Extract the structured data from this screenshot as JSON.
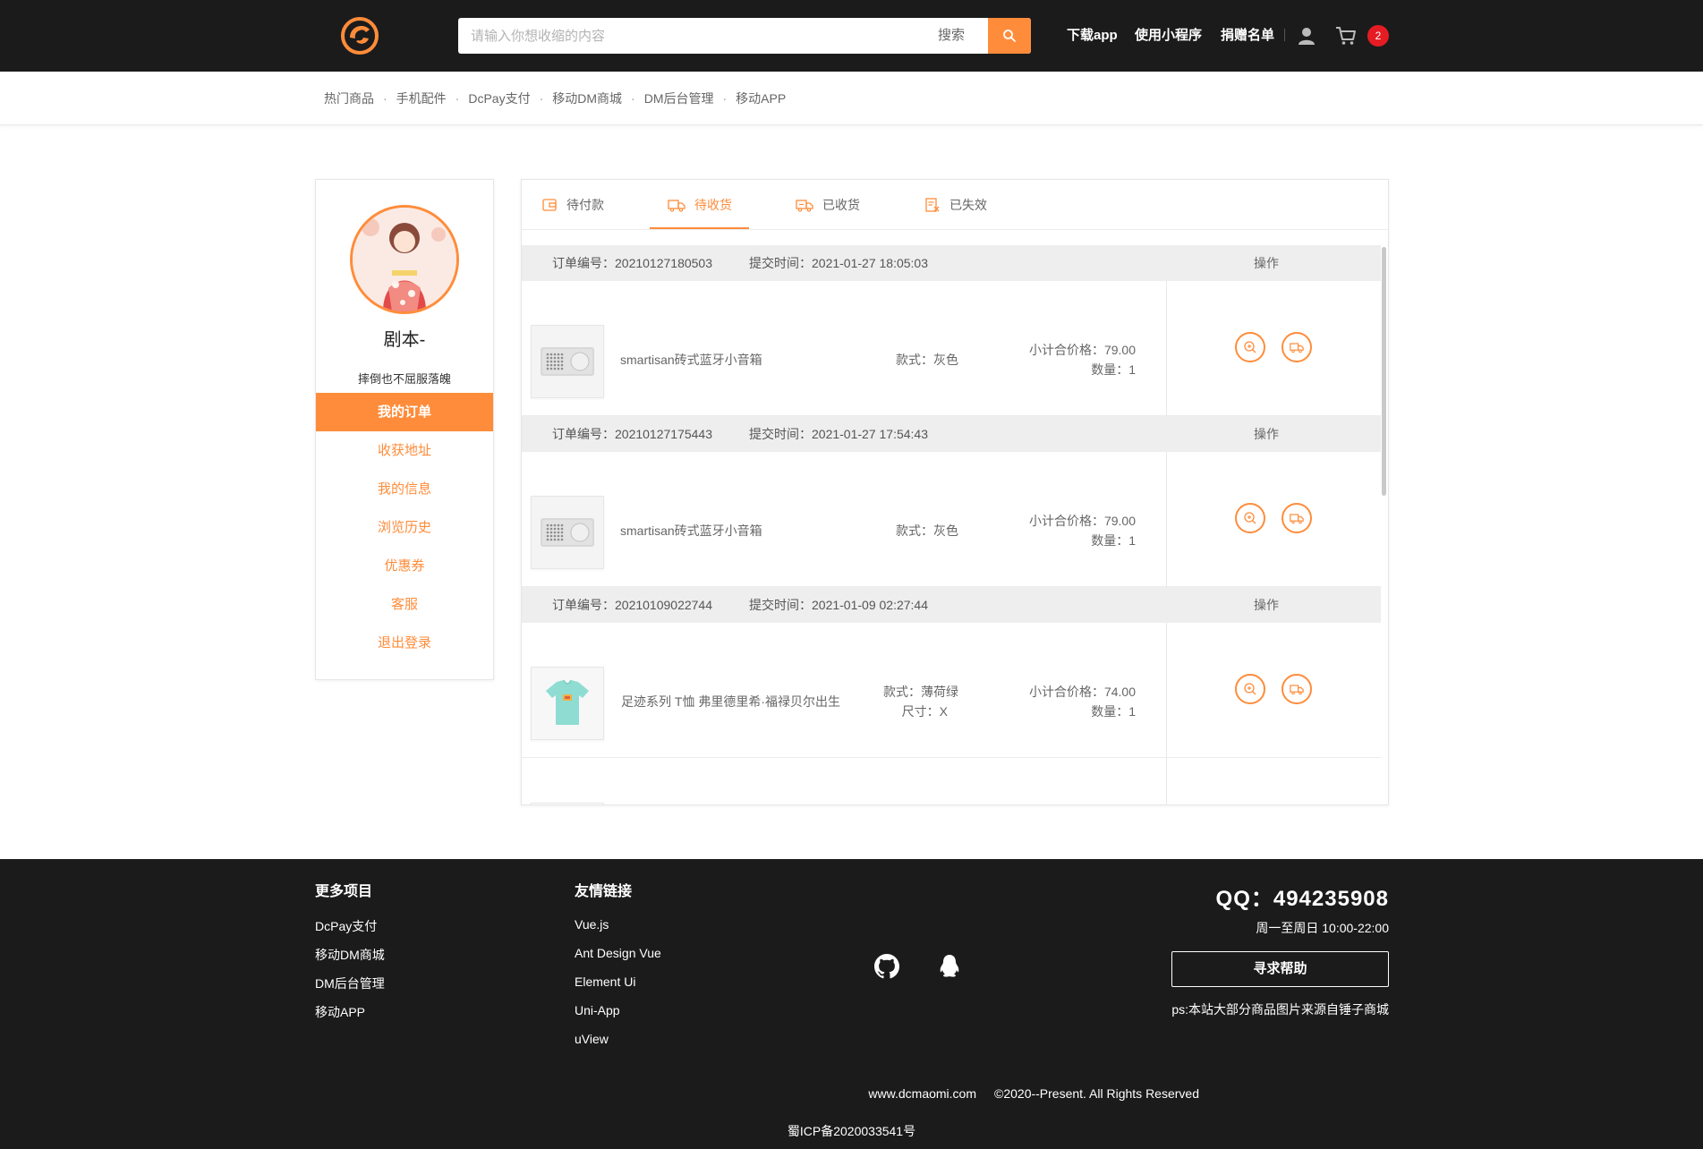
{
  "header": {
    "search_placeholder": "请输入你想收缩的内容",
    "search_label": "搜索",
    "nav_links": [
      "下载app",
      "使用小程序",
      "捐赠名单"
    ],
    "cart_count": "2",
    "accent_color": "#ff8c3a"
  },
  "subnav": {
    "items": [
      "热门商品",
      "手机配件",
      "DcPay支付",
      "移动DM商城",
      "DM后台管理",
      "移动APP"
    ],
    "separator": "·"
  },
  "sidebar": {
    "username": "剧本-",
    "signature": "摔倒也不屈服落魄",
    "menu": [
      "我的订单",
      "收获地址",
      "我的信息",
      "浏览历史",
      "优惠券",
      "客服",
      "退出登录"
    ],
    "active_index": 0
  },
  "tabs": [
    {
      "label": "待付款",
      "icon": "wallet-icon"
    },
    {
      "label": "待收货",
      "icon": "truck-icon"
    },
    {
      "label": "已收货",
      "icon": "delivered-truck-icon"
    },
    {
      "label": "已失效",
      "icon": "invalid-doc-icon"
    }
  ],
  "active_tab": 1,
  "orders": [
    {
      "no_label": "订单编号：",
      "no": "20210127180503",
      "time_label": "提交时间：",
      "time": "2021-01-27 18:05:03",
      "op_label": "操作",
      "product": "smartisan砖式蓝牙小音箱",
      "image": "speaker",
      "spec1": "款式：灰色",
      "spec2": "",
      "price": "小计合价格：79.00",
      "qty": "数量：1"
    },
    {
      "no_label": "订单编号：",
      "no": "20210127175443",
      "time_label": "提交时间：",
      "time": "2021-01-27 17:54:43",
      "op_label": "操作",
      "product": "smartisan砖式蓝牙小音箱",
      "image": "speaker",
      "spec1": "款式：灰色",
      "spec2": "",
      "price": "小计合价格：79.00",
      "qty": "数量：1"
    },
    {
      "no_label": "订单编号：",
      "no": "20210109022744",
      "time_label": "提交时间：",
      "time": "2021-01-09 02:27:44",
      "op_label": "操作",
      "product": "足迹系列 T恤 弗里德里希·福禄贝尔出生",
      "image": "tshirt",
      "spec1": "款式：薄荷绿",
      "spec2": "尺寸：X",
      "price": "小计合价格：74.00",
      "qty": "数量：1"
    }
  ],
  "footer": {
    "col1_title": "更多项目",
    "col1_links": [
      "DcPay支付",
      "移动DM商城",
      "DM后台管理",
      "移动APP"
    ],
    "col2_title": "友情链接",
    "col2_links": [
      "Vue.js",
      "Ant Design Vue",
      "Element Ui",
      "Uni-App",
      "uView"
    ],
    "qq": "QQ：494235908",
    "hours": "周一至周日 10:00-22:00",
    "help_button": "寻求帮助",
    "ps": "ps:本站大部分商品图片来源自锤子商城",
    "site": "www.dcmaomi.com",
    "copyright": "©2020--Present. All Rights Reserved",
    "icp": "蜀ICP备2020033541号"
  }
}
